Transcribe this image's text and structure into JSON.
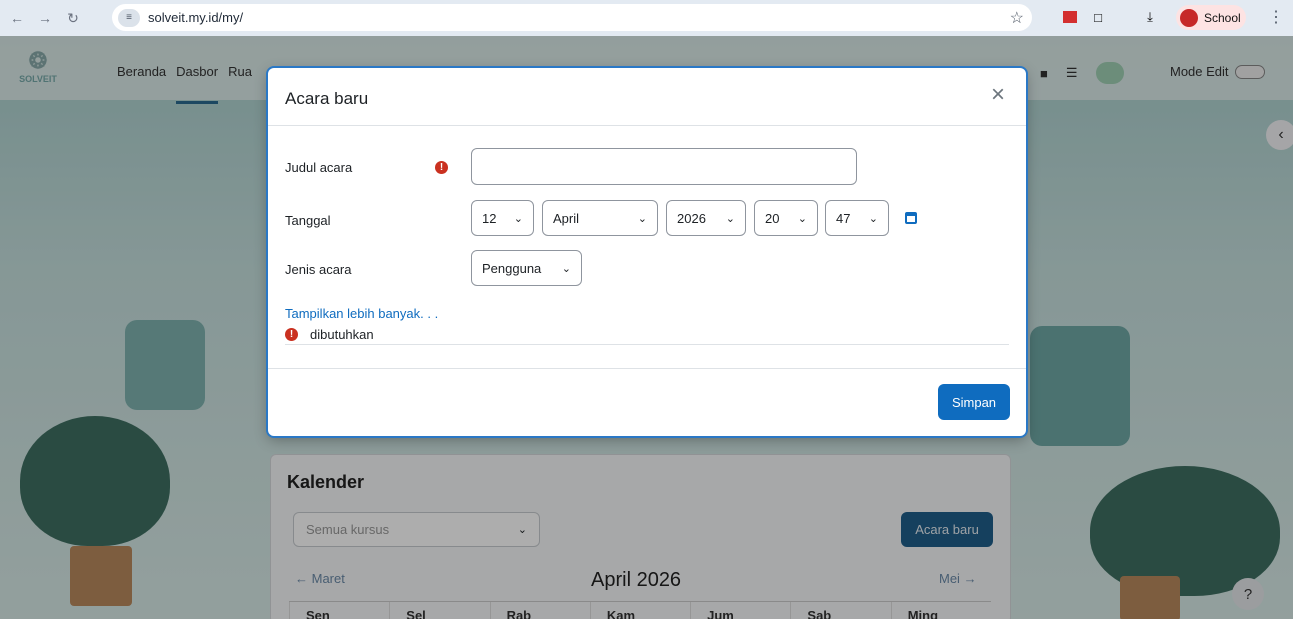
{
  "browser": {
    "url": "solveit.my.id/my/",
    "profile_name": "School"
  },
  "site": {
    "logo_text": "SOLVEIT",
    "nav": [
      "Beranda",
      "Dasbor",
      "Rua"
    ],
    "mode_edit_label": "Mode Edit"
  },
  "modal": {
    "title": "Acara baru",
    "fields": {
      "title_label": "Judul acara",
      "title_value": "",
      "date_label": "Tanggal",
      "day": "12",
      "month": "April",
      "year": "2026",
      "hour": "20",
      "minute": "47",
      "type_label": "Jenis acara",
      "type_value": "Pengguna"
    },
    "more_link": "Tampilkan lebih banyak. . .",
    "required_note": "dibutuhkan",
    "save_label": "Simpan"
  },
  "calendar": {
    "title": "Kalender",
    "course_filter": "Semua kursus",
    "new_event_label": "Acara baru",
    "prev_month": "Maret",
    "current_month": "April 2026",
    "next_month": "Mei",
    "weekdays": [
      "Sen",
      "Sel",
      "Rab",
      "Kam",
      "Jum",
      "Sab",
      "Ming"
    ]
  },
  "icons": {
    "close": "close-icon",
    "required": "exclamation-circle-icon",
    "calendar": "calendar-icon",
    "chevron": "chevron-down-icon"
  },
  "colors": {
    "primary": "#0f6cbf",
    "required": "#ca3120",
    "calendar_button": "#1f5f8b"
  }
}
